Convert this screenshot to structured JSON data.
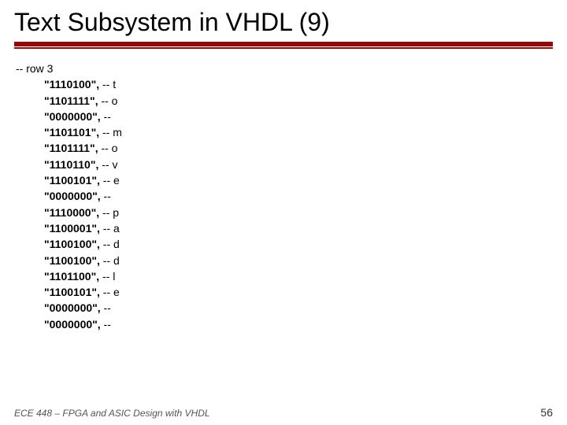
{
  "title": "Text Subsystem in VHDL (9)",
  "code": {
    "header": "-- row 3",
    "lines": [
      {
        "bits": "\"1110100\",",
        "comment": " -- t"
      },
      {
        "bits": "\"1101111\",",
        "comment": " -- o"
      },
      {
        "bits": "\"0000000\",",
        "comment": " --"
      },
      {
        "bits": "\"1101101\",",
        "comment": " -- m"
      },
      {
        "bits": "\"1101111\",",
        "comment": " -- o"
      },
      {
        "bits": "\"1110110\",",
        "comment": " -- v"
      },
      {
        "bits": "\"1100101\",",
        "comment": " -- e"
      },
      {
        "bits": "\"0000000\",",
        "comment": " --"
      },
      {
        "bits": "\"1110000\",",
        "comment": " -- p"
      },
      {
        "bits": "\"1100001\",",
        "comment": " -- a"
      },
      {
        "bits": "\"1100100\",",
        "comment": " -- d"
      },
      {
        "bits": "\"1100100\",",
        "comment": " -- d"
      },
      {
        "bits": "\"1101100\",",
        "comment": " -- l"
      },
      {
        "bits": "\"1100101\",",
        "comment": " -- e"
      },
      {
        "bits": "\"0000000\",",
        "comment": " --"
      },
      {
        "bits": "\"0000000\",",
        "comment": " --"
      }
    ]
  },
  "footer": "ECE 448 – FPGA and ASIC Design with VHDL",
  "page_number": "56"
}
